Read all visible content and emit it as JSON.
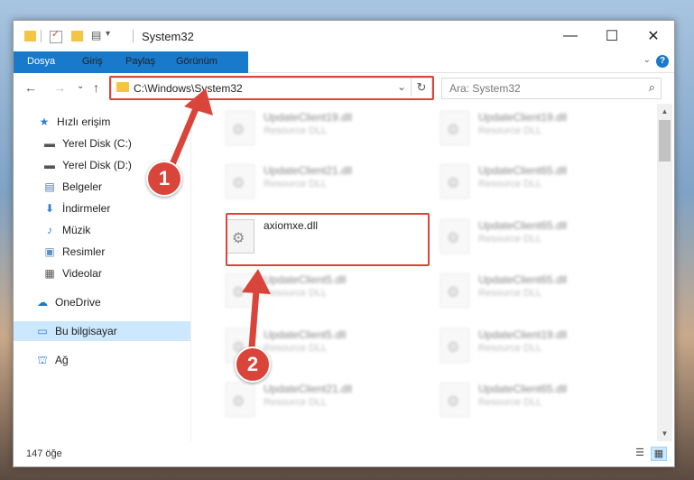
{
  "window": {
    "title": "System32",
    "minimize_glyph": "—",
    "maximize_glyph": "☐",
    "close_glyph": "✕"
  },
  "ribbon": {
    "tabs": [
      "Dosya",
      "Giriş",
      "Paylaş",
      "Görünüm"
    ],
    "help": "?",
    "collapse_glyph": "⌄"
  },
  "address": {
    "path": "C:\\Windows\\System32",
    "search_placeholder": "Ara: System32"
  },
  "nav": {
    "back": "←",
    "forward": "→",
    "recent": "⌄",
    "up": "↑",
    "dropdown": "⌄",
    "refresh": "↻",
    "search_glyph": "⌕"
  },
  "sidebar": {
    "items": [
      {
        "label": "Hızlı erişim",
        "icon": "star-icon",
        "glyph": "★",
        "color": "#2f7ed8"
      },
      {
        "label": "Yerel Disk (C:)",
        "icon": "drive-icon",
        "glyph": "▬",
        "color": "#555555",
        "pin": "⯆"
      },
      {
        "label": "Yerel Disk (D:)",
        "icon": "drive-icon",
        "glyph": "▬",
        "color": "#555555",
        "pin": "⯆"
      },
      {
        "label": "Belgeler",
        "icon": "documents-icon",
        "glyph": "▤",
        "color": "#4a7ab5",
        "pin": "⯆"
      },
      {
        "label": "İndirmeler",
        "icon": "download-icon",
        "glyph": "⬇",
        "color": "#2f7ed8",
        "pin": "⯆"
      },
      {
        "label": "Müzik",
        "icon": "music-icon",
        "glyph": "♪",
        "color": "#2f7ed8",
        "pin": "⯆"
      },
      {
        "label": "Resimler",
        "icon": "pictures-icon",
        "glyph": "▣",
        "color": "#5a8fc7",
        "pin": "⯆"
      },
      {
        "label": "Videolar",
        "icon": "video-icon",
        "glyph": "▦",
        "color": "#555555",
        "pin": "⯆"
      },
      {
        "label": "OneDrive",
        "icon": "cloud-icon",
        "glyph": "☁",
        "color": "#1979ca"
      },
      {
        "label": "Bu bilgisayar",
        "icon": "computer-icon",
        "glyph": "▭",
        "color": "#2f7ed8"
      },
      {
        "label": "Ağ",
        "icon": "network-icon",
        "glyph": "⛫",
        "color": "#2f7ed8"
      }
    ]
  },
  "files": [
    {
      "name": "UpdateClient19.dll",
      "type": "Resource DLL"
    },
    {
      "name": "UpdateClient19.dll",
      "type": "Resource DLL"
    },
    {
      "name": "UpdateClient21.dll",
      "type": "Resource DLL"
    },
    {
      "name": "UpdateClient65.dll",
      "type": "Resource DLL"
    },
    {
      "name": "axiomxe.dll",
      "type": ""
    },
    {
      "name": "UpdateClient65.dll",
      "type": "Resource DLL"
    },
    {
      "name": "UpdateClient5.dll",
      "type": "Resource DLL"
    },
    {
      "name": "UpdateClient65.dll",
      "type": "Resource DLL"
    },
    {
      "name": "UpdateClient5.dll",
      "type": "Resource DLL"
    },
    {
      "name": "UpdateClient19.dll",
      "type": "Resource DLL"
    },
    {
      "name": "UpdateClient21.dll",
      "type": "Resource DLL"
    },
    {
      "name": "UpdateClient65.dll",
      "type": "Resource DLL"
    }
  ],
  "status": {
    "count": "147 öğe",
    "details_view_glyph": "☰",
    "tiles_view_glyph": "▦"
  },
  "callouts": {
    "step1": "1",
    "step2": "2"
  },
  "colors": {
    "accent": "#1979ca",
    "annotation": "#d9453a",
    "selection": "#cce8ff"
  }
}
